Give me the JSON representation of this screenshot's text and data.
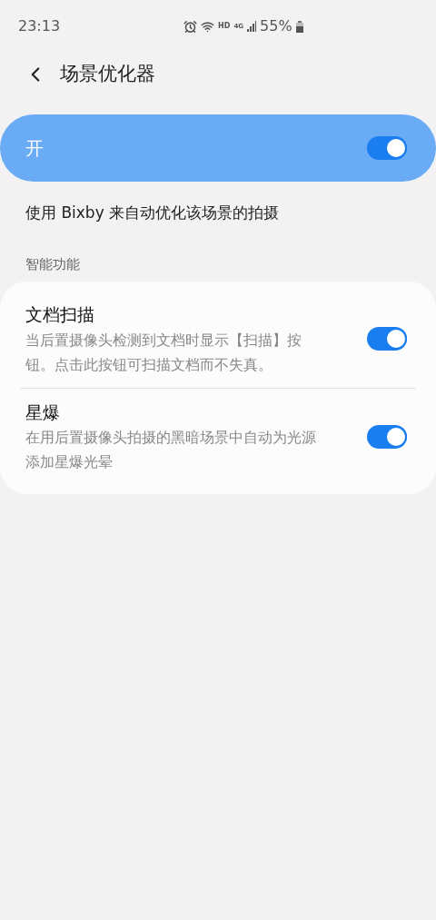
{
  "status_bar": {
    "time": "23:13",
    "network_hd": "HD",
    "network_type": "4G",
    "battery": "55%"
  },
  "header": {
    "title": "场景优化器"
  },
  "master_switch": {
    "label": "开",
    "on": true
  },
  "description": "使用 Bixby 来自动优化该场景的拍摄",
  "section": {
    "title": "智能功能",
    "items": [
      {
        "title": "文档扫描",
        "summary": "当后置摄像头检测到文档时显示【扫描】按钮。点击此按钮可扫描文档而不失真。",
        "on": true
      },
      {
        "title": "星爆",
        "summary": "在用后置摄像头拍摄的黑暗场景中自动为光源添加星爆光晕",
        "on": true
      }
    ]
  }
}
